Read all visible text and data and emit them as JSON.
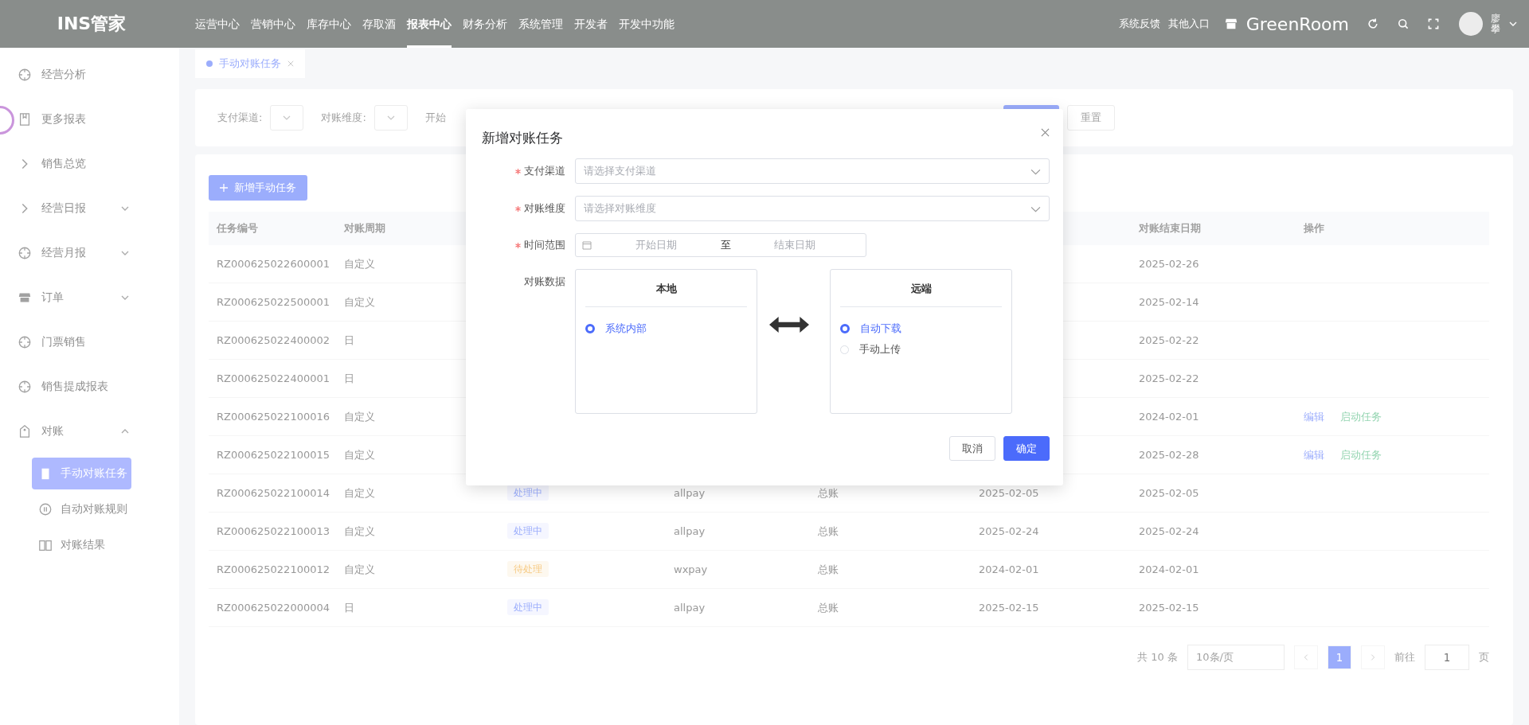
{
  "header": {
    "logo": "INS管家",
    "nav": [
      {
        "label": "运营中心",
        "selected": false
      },
      {
        "label": "营销中心",
        "selected": false
      },
      {
        "label": "库存中心",
        "selected": false
      },
      {
        "label": "存取酒",
        "selected": false
      },
      {
        "label": "报表中心",
        "selected": true
      },
      {
        "label": "财务分析",
        "selected": false
      },
      {
        "label": "系统管理",
        "selected": false
      },
      {
        "label": "开发者",
        "selected": false
      },
      {
        "label": "开发中功能",
        "selected": false
      }
    ],
    "links": [
      "系统反馈",
      "其他入口"
    ],
    "store": "GreenRoom",
    "user": "廖攀"
  },
  "sidebar": {
    "items": [
      {
        "label": "经营分析",
        "selected": false
      },
      {
        "label": "更多报表",
        "selected": false
      },
      {
        "label": "销售总览",
        "selected": false
      },
      {
        "label": "经营日报",
        "selected": false,
        "expanded": false
      },
      {
        "label": "经营月报",
        "selected": false,
        "expanded": false
      },
      {
        "label": "订单",
        "selected": false,
        "expanded": false
      },
      {
        "label": "门票销售",
        "selected": false
      },
      {
        "label": "销售提成报表",
        "selected": false
      },
      {
        "label": "对账",
        "selected": false,
        "expanded": true,
        "children": [
          {
            "label": "手动对账任务",
            "selected": true
          },
          {
            "label": "自动对账规则",
            "selected": false
          },
          {
            "label": "对账结果",
            "selected": false
          }
        ]
      }
    ]
  },
  "tabs": [
    {
      "label": "手动对账任务",
      "selected": true
    }
  ],
  "filters": {
    "fields": [
      {
        "label": "支付渠道:"
      },
      {
        "label": "对账维度:"
      },
      {
        "label": "开始"
      }
    ],
    "reset": "重置"
  },
  "add_button": "新增手动任务",
  "table": {
    "columns": [
      "任务编号",
      "对账周期",
      "对账结束日期",
      "操作"
    ],
    "rows": [
      {
        "id": "RZ000625022600001",
        "period": "自定义",
        "end": "2025-02-26"
      },
      {
        "id": "RZ000625022500001",
        "period": "自定义",
        "end": "2025-02-14"
      },
      {
        "id": "RZ000625022400002",
        "period": "日",
        "end": "2025-02-22"
      },
      {
        "id": "RZ000625022400001",
        "period": "日",
        "end": "2025-02-22"
      },
      {
        "id": "RZ000625022100016",
        "period": "自定义",
        "end": "2024-02-01",
        "actions": [
          "编辑",
          "启动任务"
        ]
      },
      {
        "id": "RZ000625022100015",
        "period": "自定义",
        "end": "2025-02-28",
        "actions": [
          "编辑",
          "启动任务"
        ]
      },
      {
        "id": "RZ000625022100014",
        "period": "自定义",
        "status": {
          "label": "处理中",
          "kind": "processing"
        },
        "channel": "allpay",
        "dimension": "总账",
        "start": "2025-02-05",
        "end": "2025-02-05"
      },
      {
        "id": "RZ000625022100013",
        "period": "自定义",
        "status": {
          "label": "处理中",
          "kind": "processing"
        },
        "channel": "allpay",
        "dimension": "总账",
        "start": "2025-02-24",
        "end": "2025-02-24"
      },
      {
        "id": "RZ000625022100012",
        "period": "自定义",
        "status": {
          "label": "待处理",
          "kind": "pending"
        },
        "channel": "wxpay",
        "dimension": "总账",
        "start": "2024-02-01",
        "end": "2024-02-01"
      },
      {
        "id": "RZ000625022000004",
        "period": "日",
        "status": {
          "label": "处理中",
          "kind": "processing"
        },
        "channel": "allpay",
        "dimension": "总账",
        "start": "2025-02-15",
        "end": "2025-02-15"
      }
    ]
  },
  "pagination": {
    "total": "共 10 条",
    "page_size": "10条/页",
    "pages": [
      {
        "label": "1",
        "selected": true
      }
    ],
    "goto": "前往",
    "goto_value": "1",
    "goto_suffix": "页"
  },
  "dialog": {
    "title": "新增对账任务",
    "fields": [
      {
        "label": "支付渠道",
        "required": true,
        "kind": "select",
        "placeholder": "请选择支付渠道"
      },
      {
        "label": "对账维度",
        "required": true,
        "kind": "select",
        "placeholder": "请选择对账维度"
      },
      {
        "label": "时间范围",
        "required": true,
        "kind": "daterange",
        "start": "开始日期",
        "separator": "至",
        "end": "结束日期"
      }
    ],
    "data_label": "对账数据",
    "local": {
      "title": "本地",
      "options": [
        {
          "label": "系统内部",
          "selected": true
        }
      ]
    },
    "remote": {
      "title": "远端",
      "options": [
        {
          "label": "自动下载",
          "selected": true
        },
        {
          "label": "手动上传",
          "selected": false
        }
      ]
    },
    "buttons": [
      {
        "label": "取消",
        "kind": "default"
      },
      {
        "label": "确定",
        "kind": "primary"
      }
    ]
  }
}
